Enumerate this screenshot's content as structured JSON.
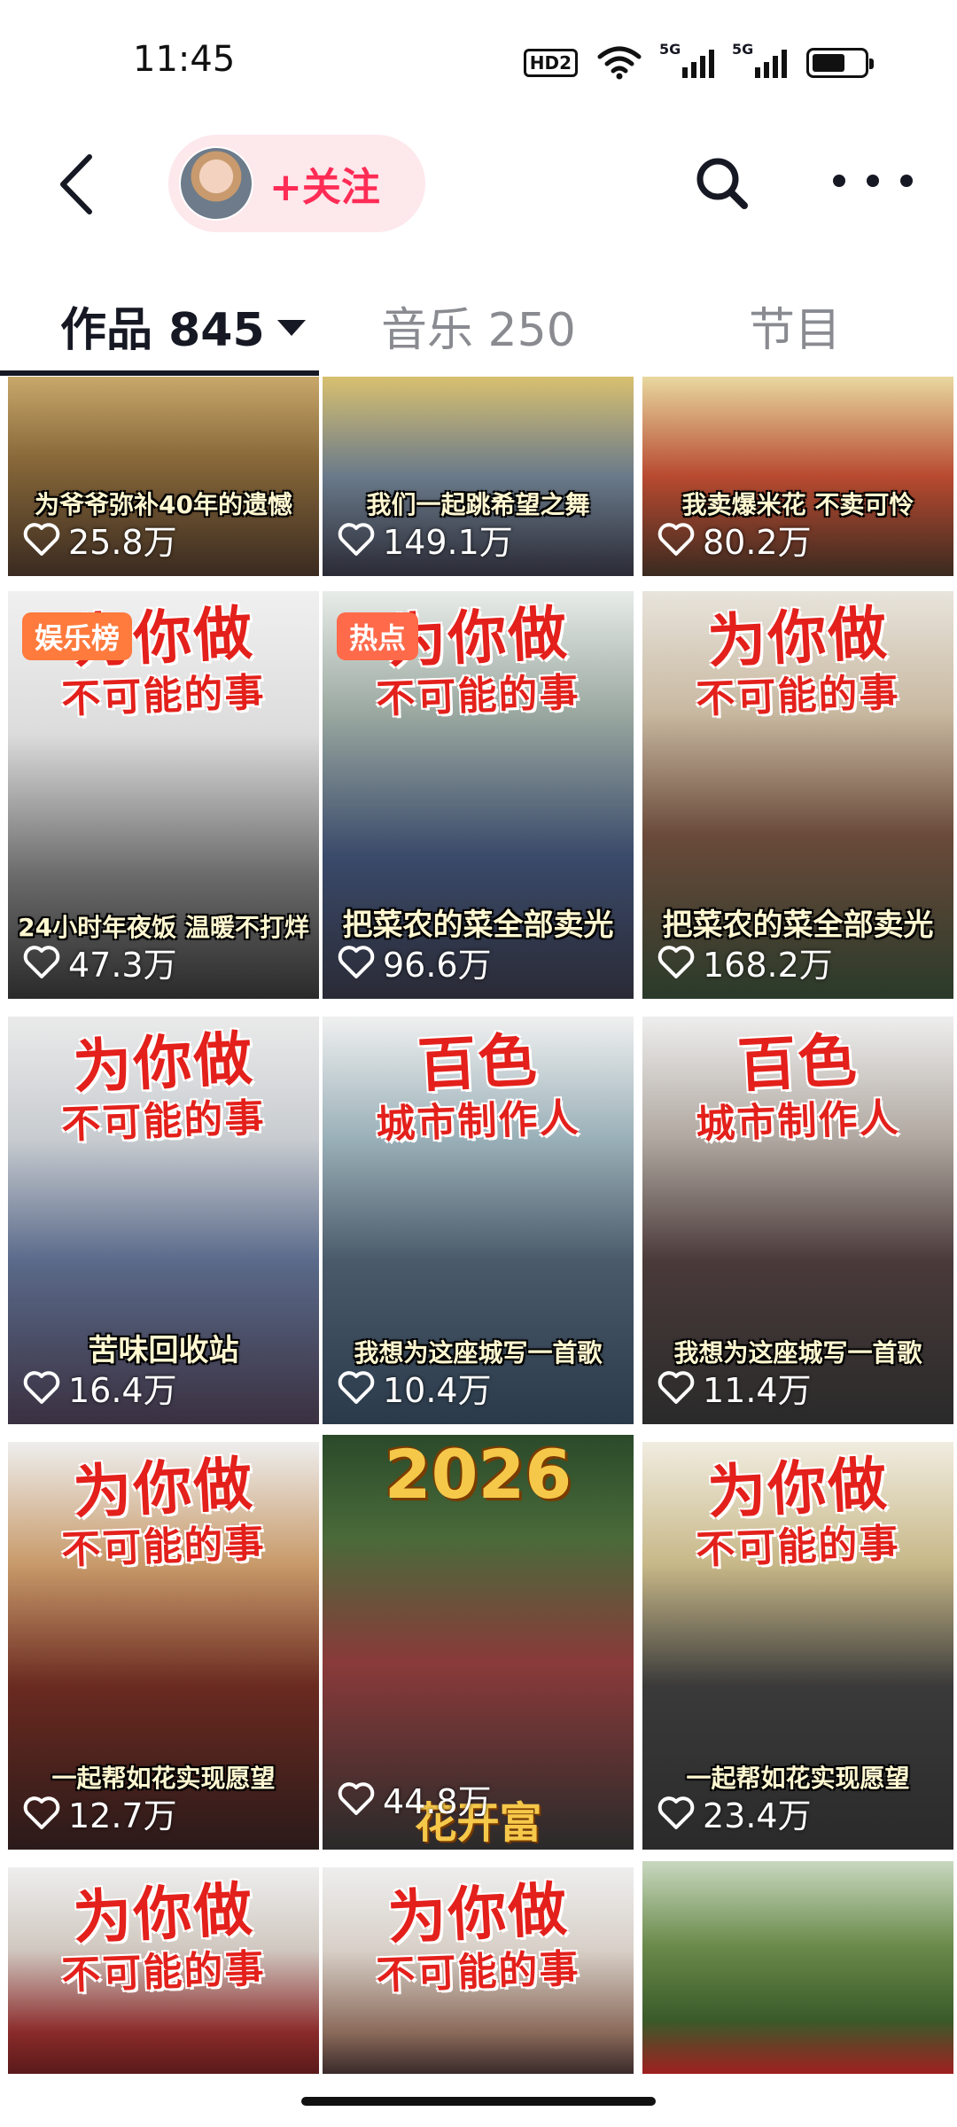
{
  "status_bar": {
    "time": "11:45",
    "hd_label": "HD2",
    "signal1_label": "5G",
    "signal2_label": "5G",
    "battery_level": 0.65,
    "icons": [
      "hd-voice-icon",
      "wifi-icon",
      "signal-5g-icon",
      "signal-5g-icon",
      "battery-icon"
    ]
  },
  "header": {
    "back_icon": "chevron-left-icon",
    "follow_label": "+关注",
    "search_icon": "search-icon",
    "more_icon": "more-dots-icon"
  },
  "tabs": [
    {
      "label": "作品 845",
      "active": true
    },
    {
      "label": "音乐 250",
      "active": false
    },
    {
      "label": "节目",
      "active": false
    }
  ],
  "colors": {
    "accent": "#fe2c55",
    "follow_bg": "#fde8ec",
    "title_red": "#e3201b"
  },
  "videos": [
    {
      "caption": "为爷爷弥补40年的遗憾",
      "likes": "25.8万"
    },
    {
      "caption": "我们一起跳希望之舞",
      "likes": "149.1万"
    },
    {
      "caption": "我卖爆米花 不卖可怜",
      "likes": "80.2万"
    },
    {
      "badge": "娱乐榜",
      "title1": "为你做",
      "title2": "不可能的事",
      "caption": "24小时年夜饭 温暖不打烊",
      "likes": "47.3万"
    },
    {
      "badge": "热点",
      "title1": "为你做",
      "title2": "不可能的事",
      "caption": "把菜农的菜全部卖光",
      "likes": "96.6万"
    },
    {
      "title1": "为你做",
      "title2": "不可能的事",
      "caption": "把菜农的菜全部卖光",
      "likes": "168.2万"
    },
    {
      "title1": "为你做",
      "title2": "不可能的事",
      "caption": "苦味回收站",
      "likes": "16.4万"
    },
    {
      "title1": "百色",
      "title2": "城市制作人",
      "caption": "我想为这座城写一首歌",
      "likes": "10.4万"
    },
    {
      "title1": "百色",
      "title2": "城市制作人",
      "caption": "我想为这座城写一首歌",
      "likes": "11.4万"
    },
    {
      "title1": "为你做",
      "title2": "不可能的事",
      "caption": "一起帮如花实现愿望",
      "likes": "12.7万"
    },
    {
      "title1": "2026",
      "subtitle": "花开富",
      "likes": "44.8万"
    },
    {
      "title1": "为你做",
      "title2": "不可能的事",
      "caption": "一起帮如花实现愿望",
      "likes": "23.4万"
    },
    {
      "title1": "为你做",
      "title2": "不可能的事"
    },
    {
      "title1": "为你做",
      "title2": "不可能的事"
    },
    {}
  ]
}
